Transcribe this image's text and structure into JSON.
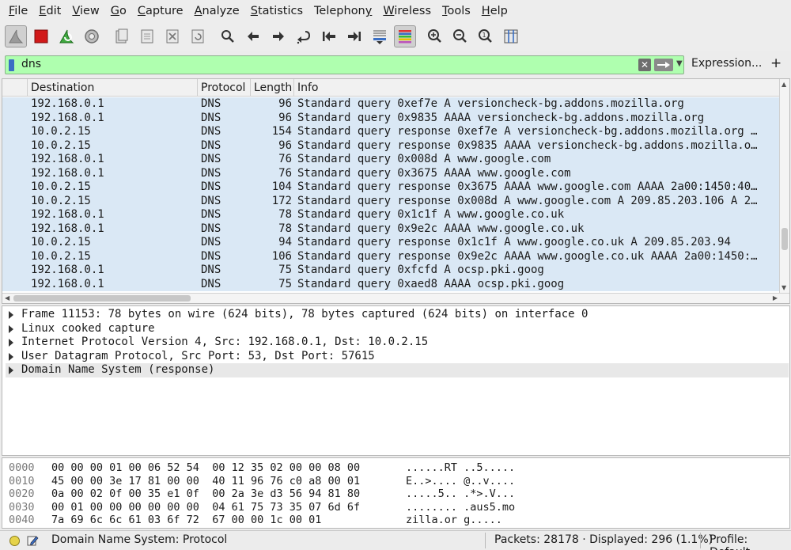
{
  "menu": [
    "File",
    "Edit",
    "View",
    "Go",
    "Capture",
    "Analyze",
    "Statistics",
    "Telephony",
    "Wireless",
    "Tools",
    "Help"
  ],
  "menu_underline": [
    "F",
    "E",
    "V",
    "G",
    "C",
    "A",
    "S",
    "y",
    "W",
    "T",
    "H"
  ],
  "toolbar_icons": [
    "shark-fin-icon",
    "stop-capture-icon",
    "restart-capture-icon",
    "capture-options-icon",
    "open-file-icon",
    "save-file-icon",
    "close-file-icon",
    "reload-file-icon",
    "find-packet-icon",
    "go-back-icon",
    "go-forward-icon",
    "go-to-packet-icon",
    "first-packet-icon",
    "last-packet-icon",
    "auto-scroll-icon",
    "colorize-icon",
    "zoom-in-icon",
    "zoom-out-icon",
    "zoom-normal-icon",
    "resize-columns-icon"
  ],
  "filter": {
    "value": "dns",
    "bg_color": "#afffaf",
    "expression_label": "Expression...",
    "plus_label": "+"
  },
  "packet_list": {
    "columns": [
      "Destination",
      "Protocol",
      "Length",
      "Info"
    ],
    "rows": [
      {
        "dst": "192.168.0.1",
        "proto": "DNS",
        "len": "96",
        "info": "Standard query 0xef7e A versioncheck-bg.addons.mozilla.org"
      },
      {
        "dst": "192.168.0.1",
        "proto": "DNS",
        "len": "96",
        "info": "Standard query 0x9835 AAAA versioncheck-bg.addons.mozilla.org"
      },
      {
        "dst": "10.0.2.15",
        "proto": "DNS",
        "len": "154",
        "info": "Standard query response 0xef7e A versioncheck-bg.addons.mozilla.org …"
      },
      {
        "dst": "10.0.2.15",
        "proto": "DNS",
        "len": "96",
        "info": "Standard query response 0x9835 AAAA versioncheck-bg.addons.mozilla.o…"
      },
      {
        "dst": "192.168.0.1",
        "proto": "DNS",
        "len": "76",
        "info": "Standard query 0x008d A www.google.com"
      },
      {
        "dst": "192.168.0.1",
        "proto": "DNS",
        "len": "76",
        "info": "Standard query 0x3675 AAAA www.google.com"
      },
      {
        "dst": "10.0.2.15",
        "proto": "DNS",
        "len": "104",
        "info": "Standard query response 0x3675 AAAA www.google.com AAAA 2a00:1450:40…"
      },
      {
        "dst": "10.0.2.15",
        "proto": "DNS",
        "len": "172",
        "info": "Standard query response 0x008d A www.google.com A 209.85.203.106 A 2…"
      },
      {
        "dst": "192.168.0.1",
        "proto": "DNS",
        "len": "78",
        "info": "Standard query 0x1c1f A www.google.co.uk"
      },
      {
        "dst": "192.168.0.1",
        "proto": "DNS",
        "len": "78",
        "info": "Standard query 0x9e2c AAAA www.google.co.uk"
      },
      {
        "dst": "10.0.2.15",
        "proto": "DNS",
        "len": "94",
        "info": "Standard query response 0x1c1f A www.google.co.uk A 209.85.203.94"
      },
      {
        "dst": "10.0.2.15",
        "proto": "DNS",
        "len": "106",
        "info": "Standard query response 0x9e2c AAAA www.google.co.uk AAAA 2a00:1450:…"
      },
      {
        "dst": "192.168.0.1",
        "proto": "DNS",
        "len": "75",
        "info": "Standard query 0xfcfd A ocsp.pki.goog"
      },
      {
        "dst": "192.168.0.1",
        "proto": "DNS",
        "len": "75",
        "info": "Standard query 0xaed8 AAAA ocsp.pki.goog"
      }
    ],
    "row_color": "#dae8f5"
  },
  "details": [
    "Frame 11153: 78 bytes on wire (624 bits), 78 bytes captured (624 bits) on interface 0",
    "Linux cooked capture",
    "Internet Protocol Version 4, Src: 192.168.0.1, Dst: 10.0.2.15",
    "User Datagram Protocol, Src Port: 53, Dst Port: 57615",
    "Domain Name System (response)"
  ],
  "hex": [
    {
      "off": "0000",
      "bytes": "00 00 00 01 00 06 52 54  00 12 35 02 00 00 08 00",
      "ascii": "......RT ..5....."
    },
    {
      "off": "0010",
      "bytes": "45 00 00 3e 17 81 00 00  40 11 96 76 c0 a8 00 01",
      "ascii": "E..>.... @..v...."
    },
    {
      "off": "0020",
      "bytes": "0a 00 02 0f 00 35 e1 0f  00 2a 3e d3 56 94 81 80",
      "ascii": ".....5.. .*>.V..."
    },
    {
      "off": "0030",
      "bytes": "00 01 00 00 00 00 00 00  04 61 75 73 35 07 6d 6f",
      "ascii": "........ .aus5.mo"
    },
    {
      "off": "0040",
      "bytes": "7a 69 6c 6c 61 03 6f 72  67 00 00 1c 00 01",
      "ascii": "zilla.or g....."
    }
  ],
  "status": {
    "field": "Domain Name System: Protocol",
    "packets": "Packets: 28178 · Displayed: 296 (1.1%)",
    "profile": "Profile: Default"
  }
}
